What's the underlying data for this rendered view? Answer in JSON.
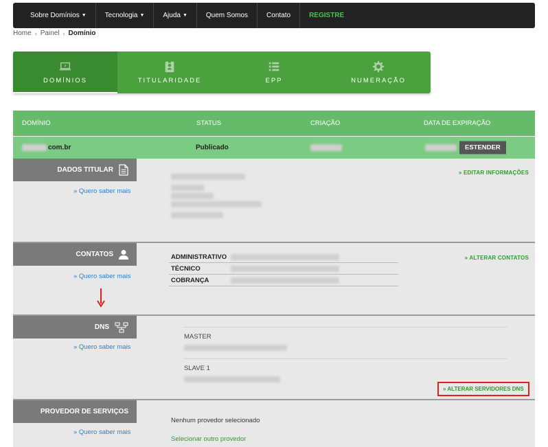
{
  "nav": {
    "items": [
      {
        "label": "Sobre Domínios",
        "dropdown": true
      },
      {
        "label": "Tecnologia",
        "dropdown": true
      },
      {
        "label": "Ajuda",
        "dropdown": true
      },
      {
        "label": "Quem Somos",
        "dropdown": false
      },
      {
        "label": "Contato",
        "dropdown": false
      }
    ],
    "register_label": "REGISTRE"
  },
  "breadcrumb": {
    "home": "Home",
    "panel": "Painel",
    "current": "Domínio"
  },
  "tabs": [
    {
      "label": "DOMÍNIOS",
      "icon": "laptop-icon",
      "active": true
    },
    {
      "label": "TITULARIDADE",
      "icon": "id-badge-icon",
      "active": false
    },
    {
      "label": "EPP",
      "icon": "list-icon",
      "active": false
    },
    {
      "label": "NUMERAÇÃO",
      "icon": "gear-icon",
      "active": false
    }
  ],
  "domain_table": {
    "headers": {
      "domain": "DOMÍNIO",
      "status": "STATUS",
      "created": "CRIAÇÃO",
      "expires": "DATA DE EXPIRAÇÃO"
    },
    "row": {
      "domain_suffix": "com.br",
      "status": "Publicado",
      "extend_label": "ESTENDER"
    }
  },
  "sections": {
    "titular": {
      "label": "DADOS TITULAR",
      "icon": "document-icon",
      "learn_more": "» Quero saber mais",
      "action": "» EDITAR INFORMAÇÕES"
    },
    "contacts": {
      "label": "CONTATOS",
      "icon": "user-icon",
      "learn_more": "» Quero saber mais",
      "action": "» ALTERAR CONTATOS",
      "rows": [
        "ADMINISTRATIVO",
        "TÉCNICO",
        "COBRANÇA"
      ]
    },
    "dns": {
      "label": "DNS",
      "icon": "network-icon",
      "learn_more": "» Quero saber mais",
      "master": "MASTER",
      "slave": "SLAVE 1",
      "action": "» ALTERAR SERVIDORES DNS"
    },
    "provider": {
      "label": "PROVEDOR DE SERVIÇOS",
      "learn_more": "» Quero saber mais",
      "none_selected": "Nenhum provedor selecionado",
      "select_other": "Selecionar outro provedor"
    }
  },
  "colors": {
    "nav_bg": "#222222",
    "green_tab": "#4aa13d",
    "green_header": "#66bb6a",
    "green_row": "#7bcb82",
    "link_green": "#2e9a2e",
    "highlight_red": "#e0201c"
  }
}
